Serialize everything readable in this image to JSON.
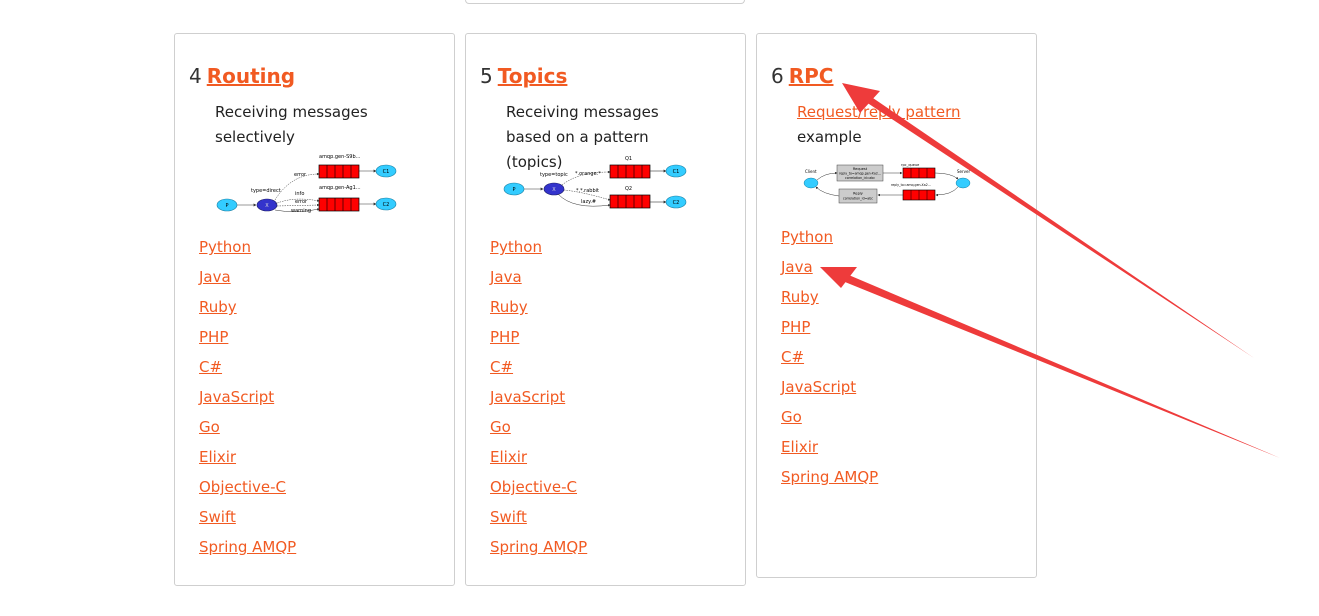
{
  "cards": [
    {
      "number": "4",
      "title": "Routing",
      "description": "Receiving messages selectively",
      "diagram": {
        "exchange_type": "type=direct",
        "routes": [
          "error",
          "info",
          "error",
          "warning"
        ],
        "queues": [
          "amqp.gen-S9b...",
          "amqp.gen-Ag1..."
        ],
        "producer": "P",
        "exchange": "X",
        "consumers": [
          "C1",
          "C2"
        ]
      },
      "links": [
        "Python",
        "Java",
        "Ruby",
        "PHP",
        "C#",
        "JavaScript",
        "Go",
        "Elixir",
        "Objective-C",
        "Swift",
        "Spring AMQP"
      ]
    },
    {
      "number": "5",
      "title": "Topics",
      "description": "Receiving messages based on a pattern (topics)",
      "diagram": {
        "exchange_type": "type=topic",
        "routes": [
          "*.orange.*",
          "*.*.rabbit",
          "lazy.#"
        ],
        "queues": [
          "Q1",
          "Q2"
        ],
        "producer": "P",
        "exchange": "X",
        "consumers": [
          "C1",
          "C2"
        ]
      },
      "links": [
        "Python",
        "Java",
        "Ruby",
        "PHP",
        "C#",
        "JavaScript",
        "Go",
        "Elixir",
        "Objective-C",
        "Swift",
        "Spring AMQP"
      ]
    },
    {
      "number": "6",
      "title": "RPC",
      "description_link": "Request/reply pattern",
      "description_rest": "example",
      "diagram": {
        "client": "Client",
        "server": "Server",
        "request_box": [
          "Request",
          "reply_to=amqp.gen-Xa2...",
          "correlation_id=abc"
        ],
        "reply_box": [
          "Reply",
          "correlation_id=abc"
        ],
        "rpc_queue": "rpc_queue",
        "reply_queue": "reply_to=amq.gen-Xa2..."
      },
      "links": [
        "Python",
        "Java",
        "Ruby",
        "PHP",
        "C#",
        "JavaScript",
        "Go",
        "Elixir",
        "Spring AMQP"
      ]
    }
  ],
  "colors": {
    "accent": "#f15a22",
    "annotation_arrow": "#ee3b3b",
    "queue_red": "#ff0000",
    "node_cyan": "#33ccff",
    "exchange_blue": "#3333cc"
  }
}
